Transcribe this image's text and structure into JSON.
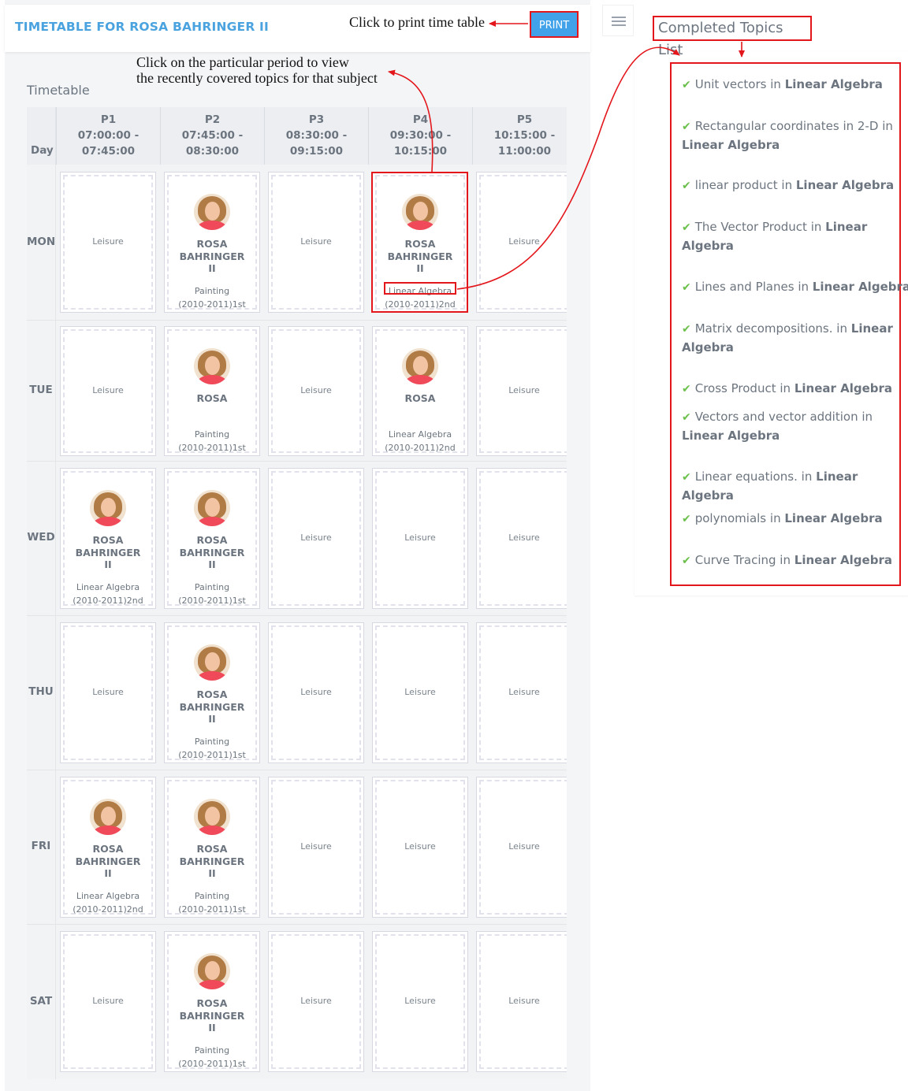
{
  "header": {
    "title": "TIMETABLE FOR ROSA BAHRINGER II",
    "print_label": "PRINT"
  },
  "annotations": {
    "print_note": "Click to print time table",
    "period_note_line1": "Click on the particular period to view",
    "period_note_line2": "the recently covered topics for that subject"
  },
  "timetable": {
    "heading": "Timetable",
    "day_header": "Day",
    "periods": [
      {
        "name": "P1",
        "start": "07:00:00 -",
        "end": "07:45:00"
      },
      {
        "name": "P2",
        "start": "07:45:00 -",
        "end": "08:30:00"
      },
      {
        "name": "P3",
        "start": "08:30:00 -",
        "end": "09:15:00"
      },
      {
        "name": "P4",
        "start": "09:30:00 -",
        "end": "10:15:00"
      },
      {
        "name": "P5",
        "start": "10:15:00 -",
        "end": "11:00:00"
      }
    ],
    "days": [
      "MON",
      "TUE",
      "WED",
      "THU",
      "FRI",
      "SAT"
    ],
    "leisure_label": "Leisure",
    "teacher_line1": "ROSA",
    "teacher_line2": "BAHRINGER",
    "teacher_line3": "II",
    "subjects": {
      "painting": {
        "name": "Painting",
        "batch": "(2010-2011)1st"
      },
      "linear": {
        "name": "Linear Algebra",
        "batch": "(2010-2011)2nd"
      }
    },
    "schedule": [
      [
        "leisure",
        "painting",
        "leisure",
        "linear",
        "leisure"
      ],
      [
        "leisure",
        "painting",
        "leisure",
        "linear",
        "leisure"
      ],
      [
        "linear",
        "painting",
        "leisure",
        "leisure",
        "leisure"
      ],
      [
        "leisure",
        "painting",
        "leisure",
        "leisure",
        "leisure"
      ],
      [
        "linear",
        "painting",
        "leisure",
        "leisure",
        "leisure"
      ],
      [
        "leisure",
        "painting",
        "leisure",
        "leisure",
        "leisure"
      ]
    ]
  },
  "topics": {
    "title": "Completed Topics List",
    "in_word": "in",
    "items": [
      {
        "topic": "Unit vectors",
        "subject": "Linear Algebra"
      },
      {
        "topic": "Rectangular coordinates in 2-D",
        "subject": "Linear Algebra"
      },
      {
        "topic": "linear product",
        "subject": "Linear Algebra"
      },
      {
        "topic": "The Vector Product",
        "subject": "Linear Algebra"
      },
      {
        "topic": "Lines and Planes",
        "subject": "Linear Algebra"
      },
      {
        "topic": "Matrix decompositions.",
        "subject": "Linear Algebra"
      },
      {
        "topic": "Cross Product",
        "subject": "Linear Algebra"
      },
      {
        "topic": "Vectors and vector addition",
        "subject": "Linear Algebra"
      },
      {
        "topic": "Linear equations.",
        "subject": "Linear Algebra"
      },
      {
        "topic": "polynomials",
        "subject": "Linear Algebra"
      },
      {
        "topic": "Curve Tracing",
        "subject": "Linear Algebra"
      }
    ]
  },
  "colors": {
    "title_blue": "#4aa3df",
    "button_blue": "#41a2ea",
    "annotation_red": "#e3161b",
    "check_green": "#6bc04b"
  },
  "icons": {
    "menu": "hamburger-menu-icon",
    "check": "check-icon",
    "avatar": "teacher-avatar"
  }
}
